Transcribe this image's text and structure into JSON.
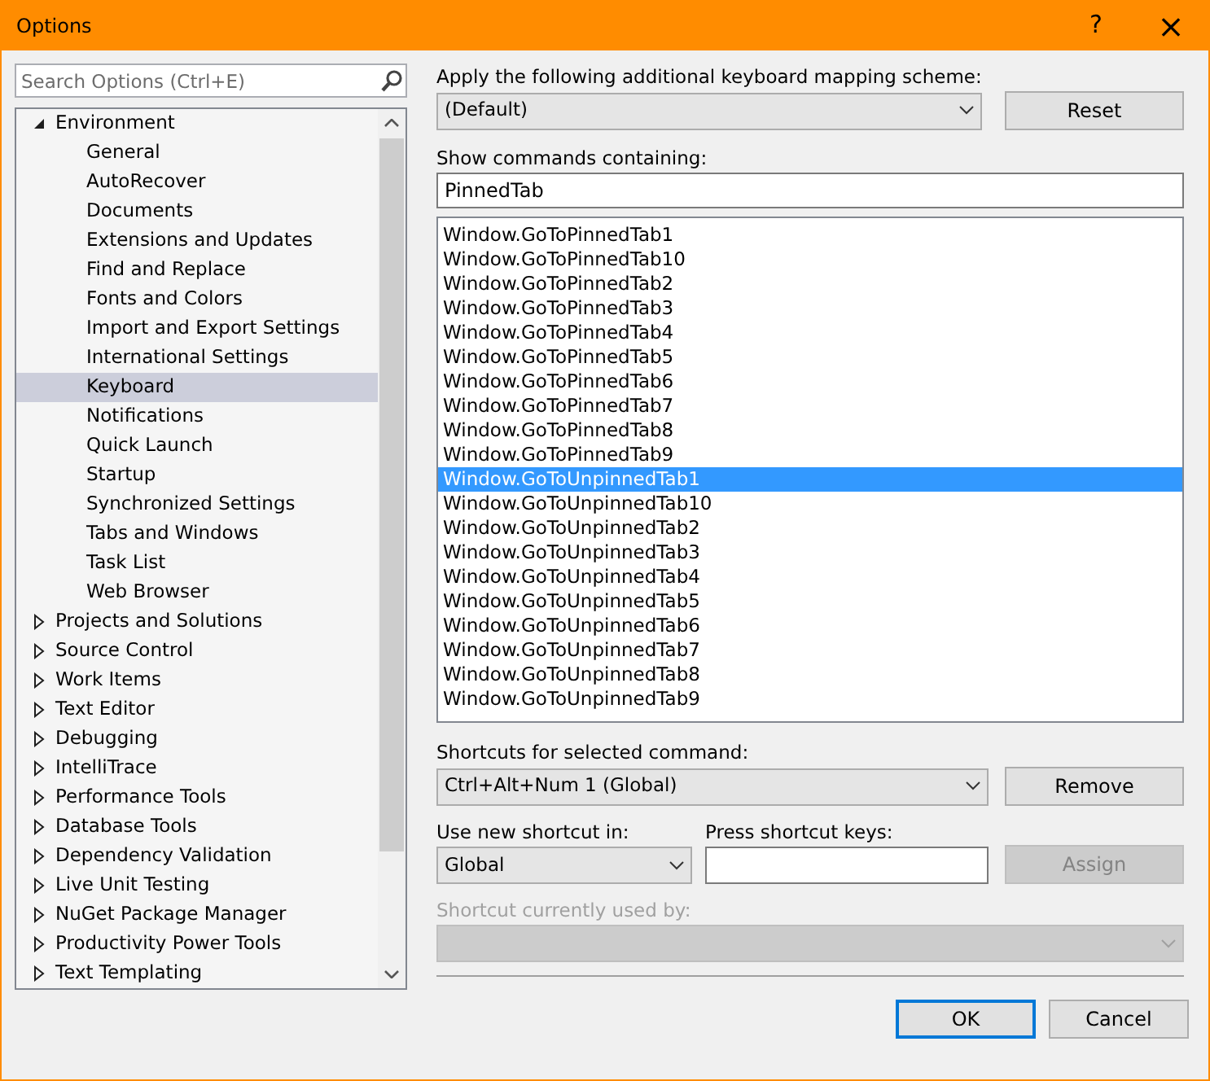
{
  "window": {
    "title": "Options",
    "buttons": [
      {
        "kind": "help",
        "text": "?"
      },
      {
        "kind": "close",
        "text": "×"
      }
    ]
  },
  "search": {
    "placeholder": "Search Options (Ctrl+E)"
  },
  "tree": [
    {
      "label": "Environment",
      "expanded": true,
      "selected": false,
      "children": [
        {
          "label": "General",
          "selected": false
        },
        {
          "label": "AutoRecover",
          "selected": false
        },
        {
          "label": "Documents",
          "selected": false
        },
        {
          "label": "Extensions and Updates",
          "selected": false
        },
        {
          "label": "Find and Replace",
          "selected": false
        },
        {
          "label": "Fonts and Colors",
          "selected": false
        },
        {
          "label": "Import and Export Settings",
          "selected": false
        },
        {
          "label": "International Settings",
          "selected": false
        },
        {
          "label": "Keyboard",
          "selected": true
        },
        {
          "label": "Notifications",
          "selected": false
        },
        {
          "label": "Quick Launch",
          "selected": false
        },
        {
          "label": "Startup",
          "selected": false
        },
        {
          "label": "Synchronized Settings",
          "selected": false
        },
        {
          "label": "Tabs and Windows",
          "selected": false
        },
        {
          "label": "Task List",
          "selected": false
        },
        {
          "label": "Web Browser",
          "selected": false
        }
      ]
    },
    {
      "label": "Projects and Solutions",
      "expanded": false,
      "selected": false
    },
    {
      "label": "Source Control",
      "expanded": false,
      "selected": false
    },
    {
      "label": "Work Items",
      "expanded": false,
      "selected": false
    },
    {
      "label": "Text Editor",
      "expanded": false,
      "selected": false
    },
    {
      "label": "Debugging",
      "expanded": false,
      "selected": false
    },
    {
      "label": "IntelliTrace",
      "expanded": false,
      "selected": false
    },
    {
      "label": "Performance Tools",
      "expanded": false,
      "selected": false
    },
    {
      "label": "Database Tools",
      "expanded": false,
      "selected": false
    },
    {
      "label": "Dependency Validation",
      "expanded": false,
      "selected": false
    },
    {
      "label": "Live Unit Testing",
      "expanded": false,
      "selected": false
    },
    {
      "label": "NuGet Package Manager",
      "expanded": false,
      "selected": false
    },
    {
      "label": "Productivity Power Tools",
      "expanded": false,
      "selected": false
    },
    {
      "label": "Text Templating",
      "expanded": false,
      "selected": false
    }
  ],
  "mapping_scheme": {
    "label": "Apply the following additional keyboard mapping scheme:",
    "value": "(Default)"
  },
  "reset_button": {
    "label": "Reset",
    "disabled": false
  },
  "commands_filter": {
    "label": "Show commands containing:",
    "value": "PinnedTab"
  },
  "commands": [
    {
      "text": "Window.GoToPinnedTab1",
      "selected": false
    },
    {
      "text": "Window.GoToPinnedTab10",
      "selected": false
    },
    {
      "text": "Window.GoToPinnedTab2",
      "selected": false
    },
    {
      "text": "Window.GoToPinnedTab3",
      "selected": false
    },
    {
      "text": "Window.GoToPinnedTab4",
      "selected": false
    },
    {
      "text": "Window.GoToPinnedTab5",
      "selected": false
    },
    {
      "text": "Window.GoToPinnedTab6",
      "selected": false
    },
    {
      "text": "Window.GoToPinnedTab7",
      "selected": false
    },
    {
      "text": "Window.GoToPinnedTab8",
      "selected": false
    },
    {
      "text": "Window.GoToPinnedTab9",
      "selected": false
    },
    {
      "text": "Window.GoToUnpinnedTab1",
      "selected": true
    },
    {
      "text": "Window.GoToUnpinnedTab10",
      "selected": false
    },
    {
      "text": "Window.GoToUnpinnedTab2",
      "selected": false
    },
    {
      "text": "Window.GoToUnpinnedTab3",
      "selected": false
    },
    {
      "text": "Window.GoToUnpinnedTab4",
      "selected": false
    },
    {
      "text": "Window.GoToUnpinnedTab5",
      "selected": false
    },
    {
      "text": "Window.GoToUnpinnedTab6",
      "selected": false
    },
    {
      "text": "Window.GoToUnpinnedTab7",
      "selected": false
    },
    {
      "text": "Window.GoToUnpinnedTab8",
      "selected": false
    },
    {
      "text": "Window.GoToUnpinnedTab9",
      "selected": false
    }
  ],
  "shortcuts": {
    "label": "Shortcuts for selected command:",
    "value": "Ctrl+Alt+Num 1 (Global)"
  },
  "remove_button": {
    "label": "Remove",
    "disabled": false
  },
  "use_in": {
    "label": "Use new shortcut in:",
    "value": "Global"
  },
  "press_keys": {
    "label": "Press shortcut keys:"
  },
  "assign_button": {
    "label": "Assign",
    "disabled": true
  },
  "used_by": {
    "label": "Shortcut currently used by:",
    "disabled": true
  },
  "footer_buttons": [
    {
      "label": "OK",
      "default": true
    },
    {
      "label": "Cancel",
      "default": false
    }
  ]
}
